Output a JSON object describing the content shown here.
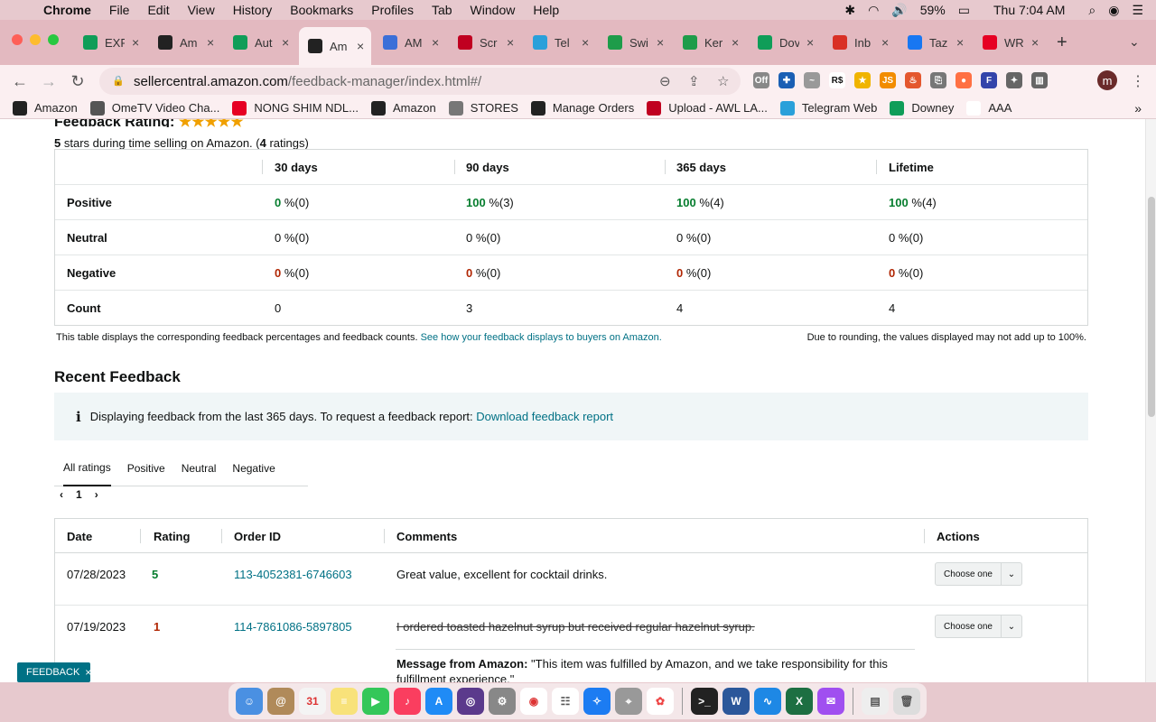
{
  "menubar": {
    "app": "Chrome",
    "items": [
      "File",
      "Edit",
      "View",
      "History",
      "Bookmarks",
      "Profiles",
      "Tab",
      "Window",
      "Help"
    ],
    "battery": "59%",
    "clock": "Thu 7:04 AM"
  },
  "tabs": [
    {
      "title": "EXP",
      "icon": "sheets-icon",
      "color": "#0f9d58"
    },
    {
      "title": "Am",
      "icon": "amazon-icon",
      "color": "#222222"
    },
    {
      "title": "Aut",
      "icon": "sheets-icon",
      "color": "#0f9d58"
    },
    {
      "title": "Am",
      "icon": "amazon-icon",
      "color": "#222222",
      "active": true
    },
    {
      "title": "AM",
      "icon": "pen-icon",
      "color": "#3b6fd8"
    },
    {
      "title": "Scr",
      "icon": "awl-icon",
      "color": "#c00020"
    },
    {
      "title": "Tel",
      "icon": "telegram-icon",
      "color": "#2aa0da"
    },
    {
      "title": "Swi",
      "icon": "sw-icon",
      "color": "#1e9c4a"
    },
    {
      "title": "Ker",
      "icon": "keepa-icon",
      "color": "#1e9c4a"
    },
    {
      "title": "Dov",
      "icon": "sheets-icon",
      "color": "#0f9d58"
    },
    {
      "title": "Inb",
      "icon": "gmail-icon",
      "color": "#d93025"
    },
    {
      "title": "Taz",
      "icon": "facebook-icon",
      "color": "#1877f2"
    },
    {
      "title": "WR",
      "icon": "pinterest-icon",
      "color": "#e60023"
    }
  ],
  "address": {
    "host": "sellercentral.amazon.com",
    "path": "/feedback-manager/index.html#/"
  },
  "profile_initial": "m",
  "bookmarks": [
    {
      "label": "Amazon",
      "icon": "amazon-icon",
      "color": "#222222"
    },
    {
      "label": "OmeTV Video Cha...",
      "icon": "globe-icon",
      "color": "#555555"
    },
    {
      "label": "NONG SHIM NDL...",
      "icon": "pinterest-icon",
      "color": "#e60023"
    },
    {
      "label": "Amazon",
      "icon": "amazon-icon",
      "color": "#222222"
    },
    {
      "label": "STORES",
      "icon": "folder-icon",
      "color": "#777777"
    },
    {
      "label": "Manage Orders",
      "icon": "amazon-icon",
      "color": "#222222"
    },
    {
      "label": "Upload - AWL LA...",
      "icon": "awl-icon",
      "color": "#c00020"
    },
    {
      "label": "Telegram Web",
      "icon": "telegram-icon",
      "color": "#2aa0da"
    },
    {
      "label": "Downey",
      "icon": "sheets-icon",
      "color": "#0f9d58"
    },
    {
      "label": "AAA",
      "icon": "amazon-icon",
      "color": "#ffffff"
    }
  ],
  "rating": {
    "title": "Feedback Rating:",
    "stars": "★★★★★",
    "summary_count": "5",
    "summary_text": " stars during time selling on Amazon. (",
    "ratings_count": "4",
    "ratings_text": " ratings)"
  },
  "rating_table": {
    "headers": [
      "30 days",
      "90 days",
      "365 days",
      "Lifetime"
    ],
    "rows": [
      {
        "label": "Positive",
        "cells": [
          {
            "n": "0",
            "t": " %(0)",
            "c": "g"
          },
          {
            "n": "100",
            "t": " %(3)",
            "c": "g"
          },
          {
            "n": "100",
            "t": " %(4)",
            "c": "g"
          },
          {
            "n": "100",
            "t": " %(4)",
            "c": "g"
          }
        ]
      },
      {
        "label": "Neutral",
        "cells": [
          {
            "n": "0",
            "t": " %(0)",
            "c": ""
          },
          {
            "n": "0",
            "t": " %(0)",
            "c": ""
          },
          {
            "n": "0",
            "t": " %(0)",
            "c": ""
          },
          {
            "n": "0",
            "t": " %(0)",
            "c": ""
          }
        ]
      },
      {
        "label": "Negative",
        "cells": [
          {
            "n": "0",
            "t": " %(0)",
            "c": "r"
          },
          {
            "n": "0",
            "t": " %(0)",
            "c": "r"
          },
          {
            "n": "0",
            "t": " %(0)",
            "c": "r"
          },
          {
            "n": "0",
            "t": " %(0)",
            "c": "r"
          }
        ]
      },
      {
        "label": "Count",
        "cells": [
          {
            "n": "",
            "t": "0",
            "c": ""
          },
          {
            "n": "",
            "t": "3",
            "c": ""
          },
          {
            "n": "",
            "t": "4",
            "c": ""
          },
          {
            "n": "",
            "t": "4",
            "c": ""
          }
        ]
      }
    ],
    "note": "This table displays the corresponding feedback percentages and feedback counts. ",
    "note_link": "See how your feedback displays to buyers on Amazon.",
    "rounding": "Due to rounding, the values displayed may not add up to 100%."
  },
  "recent": {
    "title": "Recent Feedback",
    "info_text": "Displaying feedback from the last 365 days. To request a feedback report: ",
    "info_link": "Download feedback report",
    "filters": [
      "All ratings",
      "Positive",
      "Neutral",
      "Negative"
    ],
    "page": "1",
    "headers": [
      "Date",
      "Rating",
      "Order ID",
      "Comments",
      "Actions"
    ],
    "rows": [
      {
        "date": "07/28/2023",
        "rating": "5",
        "order": "113-4052381-6746603",
        "comment": "Great value, excellent for cocktail drinks.",
        "action": "Choose one"
      },
      {
        "date": "07/19/2023",
        "rating": "1",
        "order": "114-7861086-5897805",
        "comment": "I ordered toasted hazelnut syrup but received regular hazelnut syrup.",
        "action": "Choose one",
        "message_label": "Message from Amazon:",
        "message": " \"This item was fulfilled by Amazon, and we take responsibility for this fulfillment experience.\""
      }
    ]
  },
  "feedback_tag": "FEEDBACK"
}
